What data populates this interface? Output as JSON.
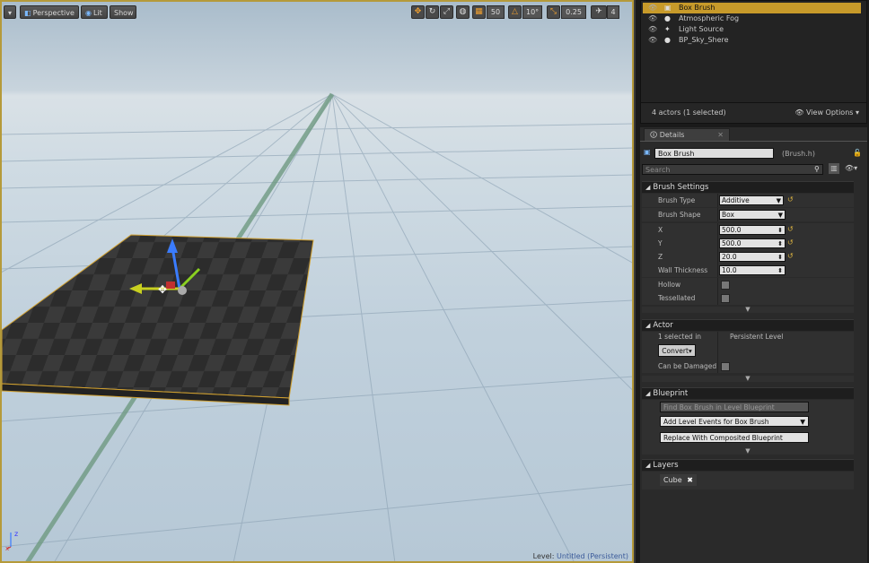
{
  "viewport": {
    "perspective_label": "Perspective",
    "lit_label": "Lit",
    "show_label": "Show",
    "grid_snap": "50",
    "rotation_snap": "10°",
    "scale_snap": "0.25",
    "camera_speed": "4",
    "level_prefix": "Level:",
    "level_name": "Untitled (Persistent)",
    "axis_x": "x",
    "axis_z": "z"
  },
  "outliner": {
    "actors": [
      {
        "label": "Box Brush",
        "selected": true
      },
      {
        "label": "Atmospheric Fog",
        "selected": false
      },
      {
        "label": "Light Source",
        "selected": false
      },
      {
        "label": "BP_Sky_Shere",
        "selected": false
      }
    ],
    "status": "4 actors (1 selected)",
    "view_options": "View Options"
  },
  "details": {
    "tab_label": "Details",
    "actor_name": "Box Brush",
    "actor_class": "(Brush.h)",
    "search_placeholder": "Search",
    "brush_settings": {
      "title": "Brush Settings",
      "brush_type_label": "Brush Type",
      "brush_type_value": "Additive",
      "brush_shape_label": "Brush Shape",
      "brush_shape_value": "Box",
      "x_label": "X",
      "x_value": "500.0",
      "y_label": "Y",
      "y_value": "500.0",
      "z_label": "Z",
      "z_value": "20.0",
      "wall_thickness_label": "Wall Thickness",
      "wall_thickness_value": "10.0",
      "hollow_label": "Hollow",
      "tessellated_label": "Tessellated"
    },
    "actor": {
      "title": "Actor",
      "selected_in_label": "1 selected in",
      "selected_in_value": "Persistent Level",
      "convert_label": "Convert",
      "can_be_damaged_label": "Can be Damaged"
    },
    "blueprint": {
      "title": "Blueprint",
      "find_label": "Find Box Brush in Level Blueprint",
      "add_events_label": "Add Level Events for Box Brush",
      "replace_label": "Replace With Composited Blueprint"
    },
    "layers": {
      "title": "Layers",
      "layer_name": "Cube"
    }
  },
  "colors": {
    "selection": "#c79a2a",
    "viewport_frame": "#b59a3a",
    "gizmo_z": "#3a7cff",
    "gizmo_x": "#c8d020"
  }
}
